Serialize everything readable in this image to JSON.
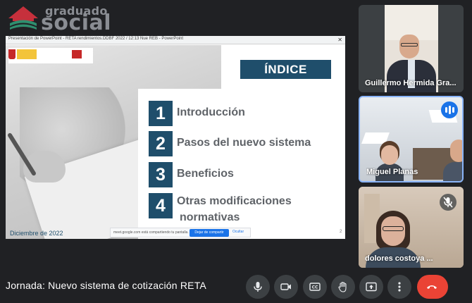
{
  "logo": {
    "line1": "graduado",
    "line2": "social"
  },
  "presentation": {
    "window_title": "Presentación de PowerPoint - RETA rendimientos.DDBF 2022 / 12:13 Nue REB - PowerPoint",
    "slide": {
      "heading": "ÍNDICE",
      "items": [
        {
          "num": "1",
          "label": "Introducción"
        },
        {
          "num": "2",
          "label": "Pasos del nuevo sistema"
        },
        {
          "num": "3",
          "label": "Beneficios"
        },
        {
          "num": "4",
          "label_line1": "Otras modificaciones",
          "label_line2": "normativas"
        }
      ],
      "date": "Diciembre de 2022",
      "page_number": "2"
    },
    "share_bar": {
      "text": "meet.google.com está compartiendo tu pantalla.",
      "stop_button": "Dejar de compartir",
      "hide_button": "Ocultar"
    }
  },
  "participants": [
    {
      "name": "Guillermo Hermida Gra...",
      "speaking": false,
      "muted": false
    },
    {
      "name": "Miguel Planas",
      "speaking": true,
      "muted": false
    },
    {
      "name": "dolores costoya ...",
      "speaking": false,
      "muted": true
    }
  ],
  "bottom_bar": {
    "meeting_title": "Jornada: Nuevo sistema de cotización RETA",
    "controls": [
      "mic-icon",
      "camera-icon",
      "captions-icon",
      "raise-hand-icon",
      "present-icon",
      "more-options-icon",
      "end-call-icon"
    ],
    "end_call_color": "#ea4335",
    "control_color": "#3c4043"
  },
  "colors": {
    "slide_accent": "#1f4e6b",
    "background": "#202124",
    "speaking_indicator": "#1a73e8"
  }
}
